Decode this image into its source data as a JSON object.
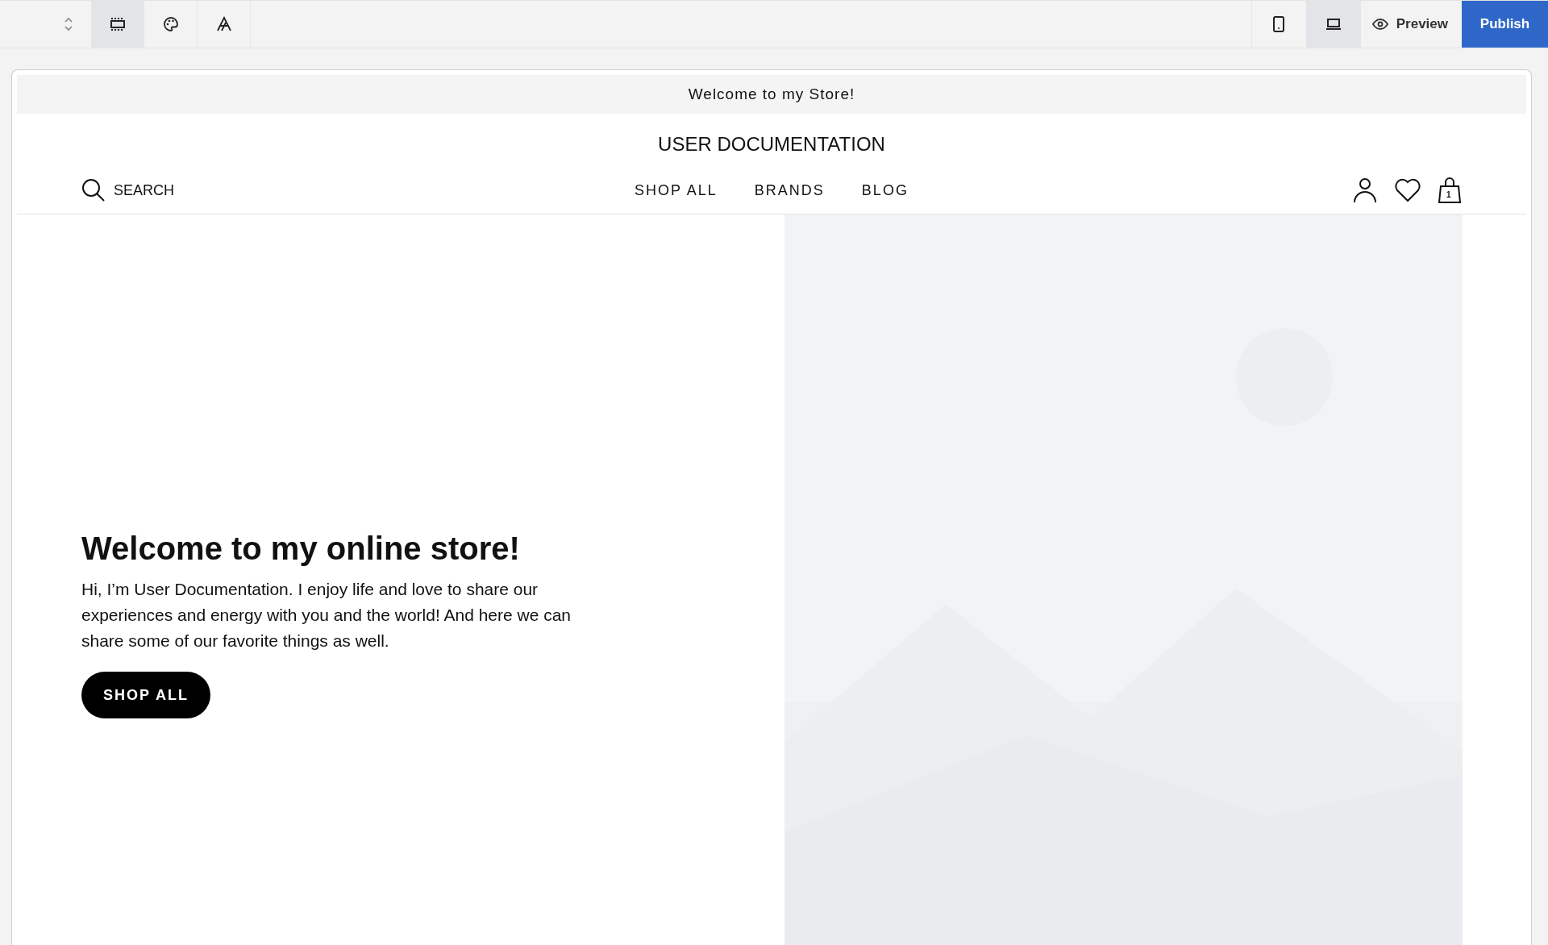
{
  "toolbar": {
    "tools": [
      {
        "kind": "sections",
        "selected": true
      },
      {
        "kind": "palette",
        "selected": false
      },
      {
        "kind": "fonts",
        "selected": false
      }
    ],
    "devices": [
      {
        "kind": "mobile",
        "selected": false
      },
      {
        "kind": "desktop",
        "selected": true
      }
    ],
    "preview": "Preview",
    "publish": "Publish"
  },
  "store": {
    "announcement": "Welcome to my Store!",
    "title": "USER DOCUMENTATION",
    "search": "SEARCH",
    "nav": [
      "SHOP ALL",
      "BRANDS",
      "BLOG"
    ],
    "cart_count": "1",
    "hero": {
      "heading": "Welcome to my online store!",
      "text": "Hi, I’m User Documentation. I enjoy life and love to share our experiences and energy with you and the world! And here we can share some of our favorite things as well.",
      "button": "SHOP ALL"
    }
  }
}
